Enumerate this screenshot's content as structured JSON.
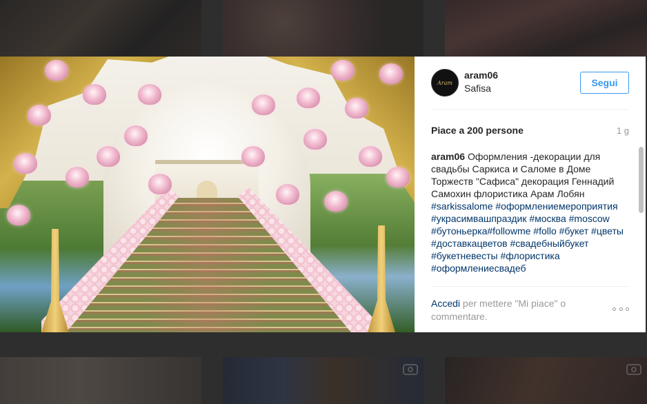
{
  "post": {
    "username": "aram06",
    "location": "Safisa",
    "follow_label": "Segui",
    "likes": "Piace a 200 persone",
    "time": "1 g",
    "caption_user": "aram06",
    "caption_text": "Оформления -декорации для свадьбы Саркиса и Саломе в Доме Торжеств \"Сафиса\" декорация Геннадий Самохин флористика Арам Лобян",
    "hashtags": [
      "#sarkissalome",
      "#оформлениемероприятия",
      "#украсимвашпраздик",
      "#москва",
      "#moscow",
      "#бутоньерка",
      "#followme",
      "#follo",
      "#букет",
      "#цветы",
      "#доставкацветов",
      "#свадебныйбукет",
      "#букетневесты",
      "#флористика",
      "#оформлениесвадеб"
    ],
    "login_link": "Accedi",
    "login_text": " per mettere \"Mi piace\" o commentare.",
    "avatar_text": "Aram"
  },
  "icons": {
    "more": "more-options-icon",
    "video": "video-camera-icon"
  }
}
